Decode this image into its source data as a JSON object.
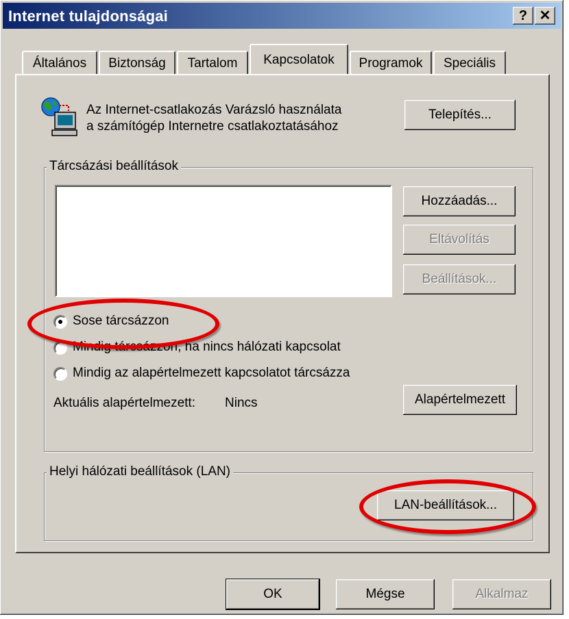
{
  "window": {
    "title": "Internet tulajdonságai",
    "help_button": "?",
    "close_button": "✕"
  },
  "tabs": [
    {
      "label": "Általános"
    },
    {
      "label": "Biztonság"
    },
    {
      "label": "Tartalom"
    },
    {
      "label": "Kapcsolatok",
      "active": true
    },
    {
      "label": "Programok"
    },
    {
      "label": "Speciális"
    }
  ],
  "setup": {
    "icon": "network-computer-icon",
    "text_line1": "Az Internet-csatlakozás Varázsló használata",
    "text_line2": "a számítógép Internetre csatlakoztatásához",
    "button": "Telepítés..."
  },
  "dialup": {
    "legend": "Tárcsázási beállítások",
    "add_button": "Hozzáadás...",
    "remove_button": "Eltávolítás",
    "settings_button": "Beállítások...",
    "radio_never": "Sose tárcsázzon",
    "radio_when_no_network": "Mindig tárcsázzon, ha nincs hálózati kapcsolat",
    "radio_always_default": "Mindig az alapértelmezett kapcsolatot tárcsázza",
    "selected": "radio_never",
    "current_default_label": "Aktuális alapértelmezett:",
    "current_default_value": "Nincs",
    "set_default_button": "Alapértelmezett"
  },
  "lan": {
    "legend": "Helyi hálózati beállítások (LAN)",
    "button": "LAN-beállítások..."
  },
  "footer": {
    "ok": "OK",
    "cancel": "Mégse",
    "apply": "Alkalmaz"
  },
  "annotation_color": "#e00000"
}
